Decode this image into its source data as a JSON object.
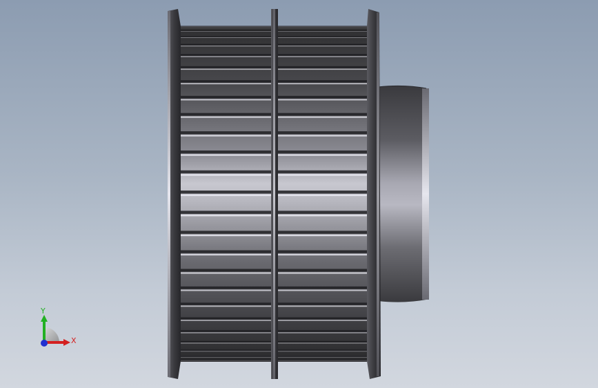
{
  "viewport": {
    "background_top": "#8c9cb1",
    "background_bottom": "#d2d7df"
  },
  "model": {
    "part": "timing-pulley",
    "tooth_count_visible": 26,
    "metal_dark": "#2a2a2c",
    "metal_light": "#d8d8de"
  },
  "triad": {
    "x_label": "X",
    "y_label": "Y",
    "x_color": "#d42020",
    "y_color": "#22b022",
    "z_color": "#2030d0"
  }
}
